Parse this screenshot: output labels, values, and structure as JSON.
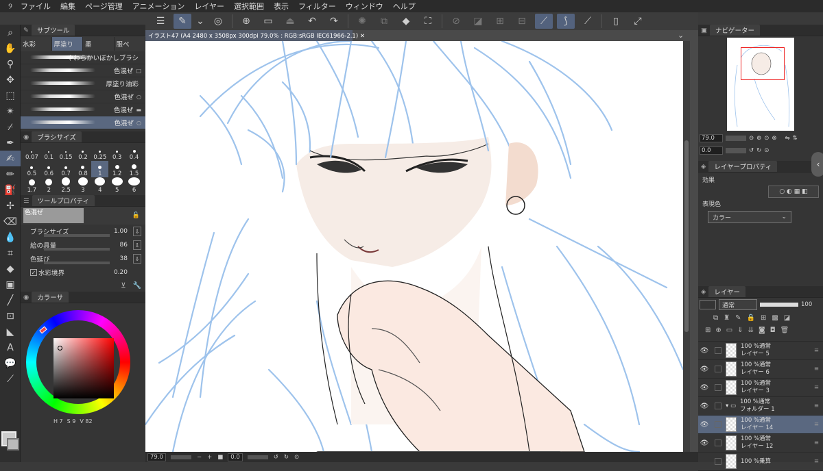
{
  "menu": [
    "ファイル",
    "編集",
    "ページ管理",
    "アニメーション",
    "レイヤー",
    "選択範囲",
    "表示",
    "フィルター",
    "ウィンドウ",
    "ヘルプ"
  ],
  "document": {
    "tab_title": "イラスト47 (A4 2480 x 3508px 300dpi 79.0% : RGB:sRGB IEC61966-2.1)"
  },
  "sub_tool": {
    "title": "サブツール",
    "tabs": [
      "水彩",
      "厚塗り",
      "墨",
      "服ぺ"
    ],
    "brushes": [
      {
        "label": "やわらかいぼかしブラシ",
        "mark": ""
      },
      {
        "label": "色混ぜ",
        "mark": "□"
      },
      {
        "label": "厚塗り油彩",
        "mark": ""
      },
      {
        "label": "色混ぜ",
        "mark": "○"
      },
      {
        "label": "色混ぜ",
        "mark": "▬"
      },
      {
        "label": "色混ぜ",
        "mark": "○"
      }
    ]
  },
  "brush_size": {
    "title": "ブラシサイズ",
    "sizes": [
      "0.07",
      "0.1",
      "0.15",
      "0.2",
      "0.25",
      "0.3",
      "0.4",
      "0.5",
      "0.6",
      "0.7",
      "0.8",
      "1",
      "1.2",
      "1.5",
      "1.7",
      "2",
      "2.5",
      "3",
      "4",
      "5",
      "6"
    ],
    "selected": "1"
  },
  "tool_property": {
    "title": "ツールプロパティ",
    "current": "色混ぜ",
    "props": [
      {
        "label": "ブラシサイズ",
        "value": "1.00"
      },
      {
        "label": "絵の具量",
        "value": "86"
      },
      {
        "label": "色延び",
        "value": "38"
      },
      {
        "label": "水彩境界",
        "value": "0.20"
      }
    ]
  },
  "color": {
    "title": "カラーサ",
    "readout": [
      "H 7",
      "S 9",
      "V 82"
    ]
  },
  "navigator": {
    "title": "ナビゲーター",
    "zoom": "79.0",
    "angle": "0.0"
  },
  "layer_property": {
    "title": "レイヤープロパティ",
    "effect_label": "効果",
    "color_label": "表現色",
    "color_value": "カラー"
  },
  "layer_panel": {
    "title": "レイヤー",
    "blend": "通常",
    "opacity": "100",
    "layers": [
      {
        "mode": "100 %通常",
        "name": "レイヤー 5",
        "selected": false
      },
      {
        "mode": "100 %通常",
        "name": "レイヤー 6",
        "selected": false
      },
      {
        "mode": "100 %通常",
        "name": "レイヤー 3",
        "selected": false
      },
      {
        "mode": "100 %通常",
        "name": "フォルダー 1",
        "selected": false
      },
      {
        "mode": "100 %通常",
        "name": "レイヤー 14",
        "selected": true
      },
      {
        "mode": "100 %通常",
        "name": "レイヤー 12",
        "selected": false
      },
      {
        "mode": "100 %乗算",
        "name": "",
        "selected": false
      }
    ]
  },
  "status": {
    "zoom": "79.0",
    "angle": "0.0"
  }
}
